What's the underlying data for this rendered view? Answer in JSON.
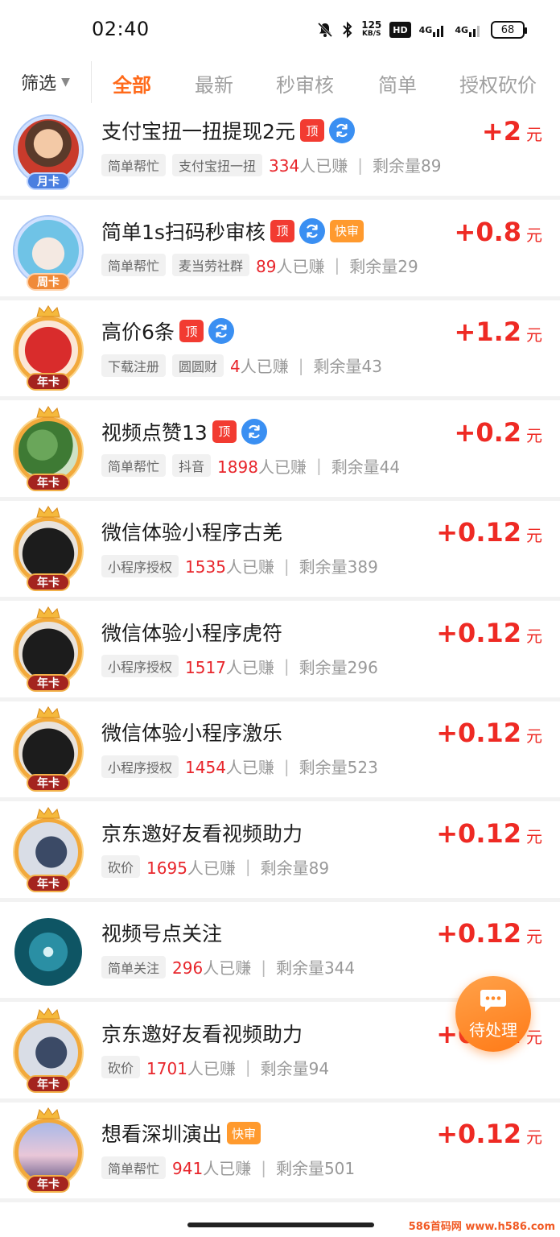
{
  "status_bar": {
    "time": "02:40",
    "speed_value": "125",
    "speed_unit": "KB/S",
    "hd": "HD",
    "net1": "4G",
    "net2": "4G",
    "battery": "68",
    "icons": [
      "mute-bell-icon",
      "bluetooth-icon",
      "signal-icon"
    ]
  },
  "tabs": {
    "filter_label": "筛选",
    "items": [
      {
        "label": "全部",
        "active": true
      },
      {
        "label": "最新",
        "active": false
      },
      {
        "label": "秒审核",
        "active": false
      },
      {
        "label": "简单",
        "active": false
      },
      {
        "label": "授权砍价",
        "active": false
      }
    ]
  },
  "tasks": [
    {
      "title": "支付宝扭一扭提现2元",
      "tags": [
        "顶",
        "refresh"
      ],
      "chips": [
        "简单帮忙",
        "支付宝扭一扭"
      ],
      "earned": "334",
      "earned_suffix": "人已赚",
      "remain": "剩余量89",
      "reward": "+2",
      "unit": "元",
      "badge": "月卡",
      "badge_type": "month",
      "avatar": "cartoon-girl"
    },
    {
      "title": "简单1s扫码秒审核",
      "tags": [
        "顶",
        "refresh",
        "快审"
      ],
      "chips": [
        "简单帮忙",
        "麦当劳社群"
      ],
      "earned": "89",
      "earned_suffix": "人已赚",
      "remain": "剩余量29",
      "reward": "+0.8",
      "unit": "元",
      "badge": "周卡",
      "badge_type": "week",
      "avatar": "sheep"
    },
    {
      "title": "高价6条",
      "tags": [
        "顶",
        "refresh"
      ],
      "chips": [
        "下载注册",
        "圆圆财"
      ],
      "earned": "4",
      "earned_suffix": "人已赚",
      "remain": "剩余量43",
      "reward": "+1.2",
      "unit": "元",
      "badge": "年卡",
      "badge_type": "year",
      "avatar": "red-seal"
    },
    {
      "title": "视频点赞13",
      "tags": [
        "顶",
        "refresh"
      ],
      "chips": [
        "简单帮忙",
        "抖音"
      ],
      "earned": "1898",
      "earned_suffix": "人已赚",
      "remain": "剩余量44",
      "reward": "+0.2",
      "unit": "元",
      "badge": "年卡",
      "badge_type": "year",
      "avatar": "plant"
    },
    {
      "title": "微信体验小程序古羌",
      "tags": [],
      "chips": [
        "小程序授权"
      ],
      "earned": "1535",
      "earned_suffix": "人已赚",
      "remain": "剩余量389",
      "reward": "+0.12",
      "unit": "元",
      "badge": "年卡",
      "badge_type": "year",
      "avatar": "black-cat"
    },
    {
      "title": "微信体验小程序虎符",
      "tags": [],
      "chips": [
        "小程序授权"
      ],
      "earned": "1517",
      "earned_suffix": "人已赚",
      "remain": "剩余量296",
      "reward": "+0.12",
      "unit": "元",
      "badge": "年卡",
      "badge_type": "year",
      "avatar": "black-cat"
    },
    {
      "title": "微信体验小程序激乐",
      "tags": [],
      "chips": [
        "小程序授权"
      ],
      "earned": "1454",
      "earned_suffix": "人已赚",
      "remain": "剩余量523",
      "reward": "+0.12",
      "unit": "元",
      "badge": "年卡",
      "badge_type": "year",
      "avatar": "black-cat"
    },
    {
      "title": "京东邀好友看视频助力",
      "tags": [],
      "chips": [
        "砍价"
      ],
      "earned": "1695",
      "earned_suffix": "人已赚",
      "remain": "剩余量89",
      "reward": "+0.12",
      "unit": "元",
      "badge": "年卡",
      "badge_type": "year",
      "avatar": "anime-figure"
    },
    {
      "title": "视频号点关注",
      "tags": [],
      "chips": [
        "简单关注"
      ],
      "earned": "296",
      "earned_suffix": "人已赚",
      "remain": "剩余量344",
      "reward": "+0.12",
      "unit": "元",
      "badge": "",
      "badge_type": "none",
      "avatar": "ocean-wave"
    },
    {
      "title": "京东邀好友看视频助力",
      "tags": [],
      "chips": [
        "砍价"
      ],
      "earned": "1701",
      "earned_suffix": "人已赚",
      "remain": "剩余量94",
      "reward": "+0.12",
      "unit": "元",
      "badge": "年卡",
      "badge_type": "year",
      "avatar": "anime-figure"
    },
    {
      "title": "想看深圳演出",
      "tags": [
        "快审"
      ],
      "chips": [
        "简单帮忙"
      ],
      "earned": "941",
      "earned_suffix": "人已赚",
      "remain": "剩余量501",
      "reward": "+0.12",
      "unit": "元",
      "badge": "年卡",
      "badge_type": "year",
      "avatar": "city-sky"
    }
  ],
  "fab": {
    "label": "待处理",
    "icon": "chat-bubble-icon"
  },
  "watermark": "586首码网 www.h586.com",
  "colors": {
    "accent": "#ff6a1a",
    "reward": "#ee2a24",
    "top_tag": "#f23b31",
    "fast_tag": "#ff9a2e",
    "refresh": "#3a8ff2"
  }
}
